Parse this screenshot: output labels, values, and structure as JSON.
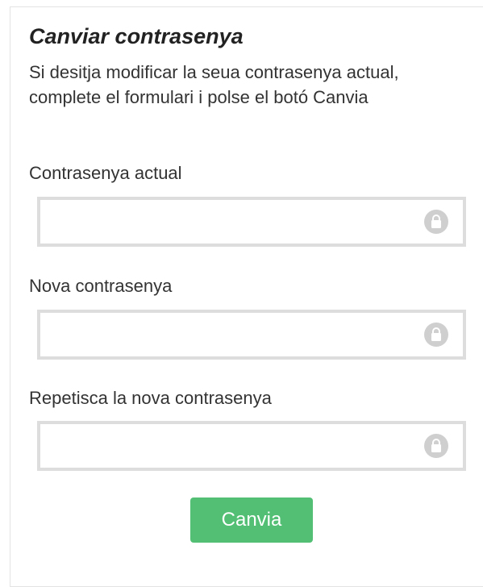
{
  "form": {
    "title": "Canviar contrasenya",
    "description": "Si desitja modificar la seua contrasenya actual, complete el formulari i polse el botó Canvia",
    "fields": {
      "current": {
        "label": "Contrasenya actual",
        "value": "",
        "icon": "lock-icon"
      },
      "new": {
        "label": "Nova contrasenya",
        "value": "",
        "icon": "lock-icon"
      },
      "repeat": {
        "label": "Repetisca la nova contrasenya",
        "value": "",
        "icon": "lock-icon"
      }
    },
    "submit_label": "Canvia"
  },
  "colors": {
    "accent": "#52bf74",
    "input_border": "#dddddd",
    "icon": "#cfcfcf"
  }
}
